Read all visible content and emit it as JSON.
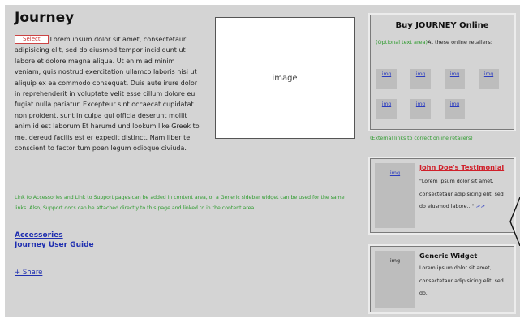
{
  "main": {
    "title": "Journey",
    "select_label": "Select",
    "intro": "Lorem ipsum dolor sit amet, consectetaur adipisicing elit, sed do eiusmod tempor incididunt ut labore et dolore magna aliqua. Ut enim ad minim veniam, quis nostrud exercitation ullamco laboris nisi ut aliquip ex ea commodo consequat. Duis aute irure dolor in reprehenderit in voluptate velit esse cillum dolore eu fugiat nulla pariatur. Excepteur sint occaecat cupidatat non proident, sunt in culpa qui officia deserunt mollit anim id est laborum Et harumd und lookum like Greek to me, dereud facilis est er expedit distinct. Nam liber te conscient to factor tum poen legum odioque civiuda.",
    "image_label": "image",
    "note": "Link to Accessories and Link to Support pages can be added in content area, or a Generic sidebar widget can be used for the same links. Also, Support docs can be attached directly to this page and linked to in the content area.",
    "links": [
      "Accessories",
      "Journey User Guide"
    ],
    "share": "+ Share"
  },
  "buy": {
    "title": "Buy JOURNEY Online",
    "optional": "(Optional text area)",
    "desc": "At these online retailers:",
    "img_label": "img",
    "external_note": "(External links to correct online retailers)"
  },
  "testimonial": {
    "img_label": "img",
    "title": "John Doe's Testimonial",
    "text": "\"Lorem ipsum dolor sit amet, consectetaur adipisicing elit, sed do eiusmod labore...\"",
    "more": ">>"
  },
  "generic": {
    "img_label": "img",
    "title": "Generic Widget",
    "text": "Lorem ipsum dolor sit amet, consectetaur adipisicing elit, sed do."
  },
  "colors": {
    "note_green": "#2e9b2e",
    "link_blue": "#1f2fb0",
    "testimonial_red": "#d0202a",
    "panel_gray": "#d4d4d4"
  }
}
